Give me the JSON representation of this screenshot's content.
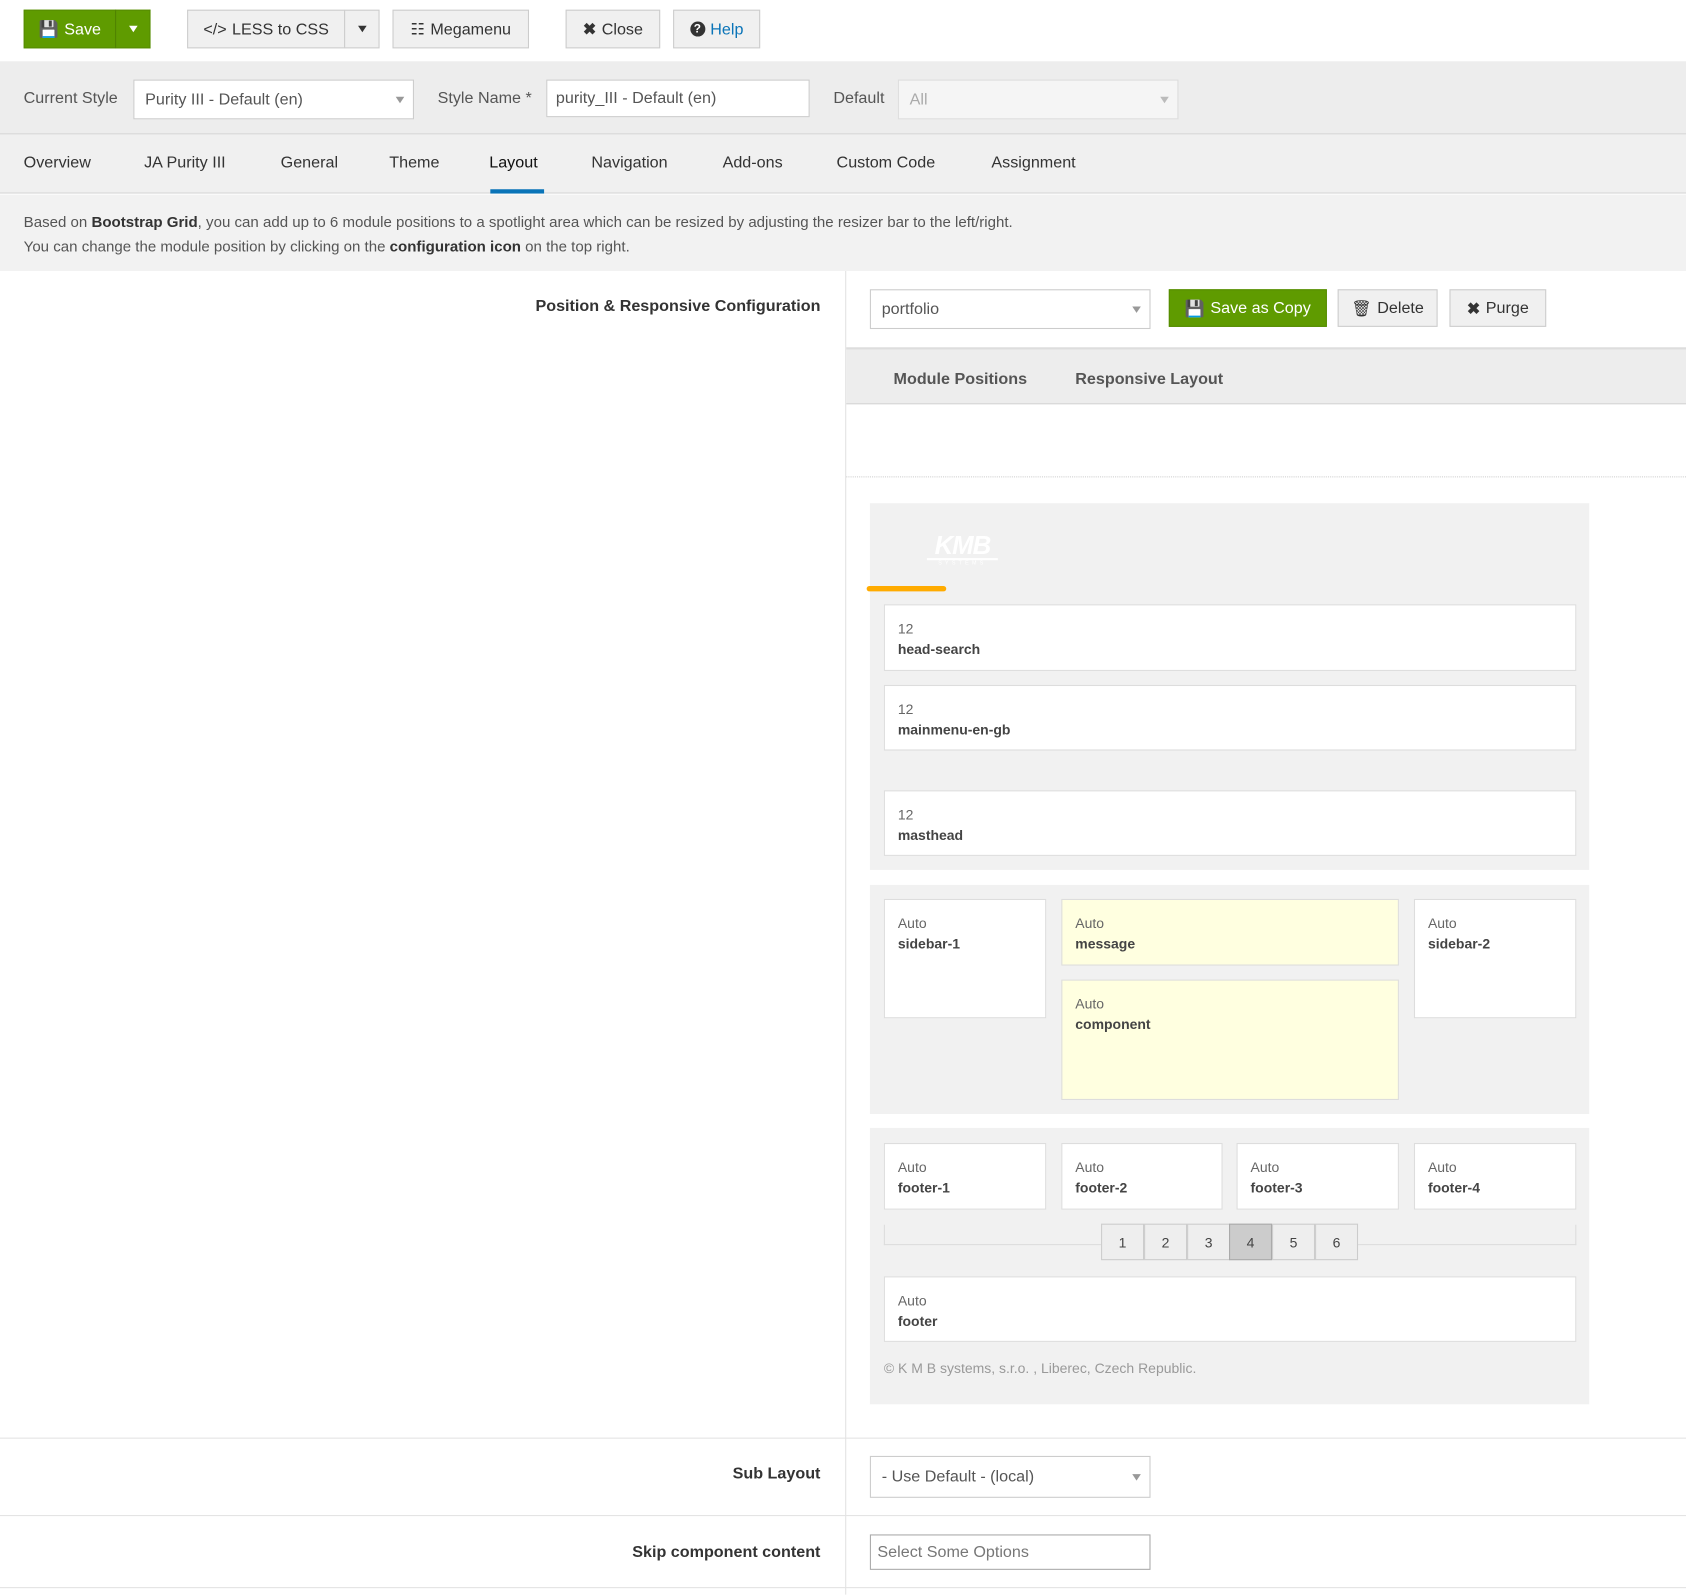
{
  "toolbar": {
    "save": "Save",
    "less": "LESS to CSS",
    "megamenu": "Megamenu",
    "close": "Close",
    "help": "Help"
  },
  "style_bar": {
    "current_style_label": "Current Style",
    "current_style_value": "Purity III - Default (en)",
    "style_name_label": "Style Name *",
    "style_name_value": "purity_III - Default (en)",
    "default_label": "Default",
    "default_value": "All"
  },
  "tabs": [
    "Overview",
    "JA Purity III",
    "General",
    "Theme",
    "Layout",
    "Navigation",
    "Add-ons",
    "Custom Code",
    "Assignment"
  ],
  "active_tab": "Layout",
  "info": {
    "l1a": "Based on ",
    "l1b": "Bootstrap Grid",
    "l1c": ", you can add up to 6 module positions to a spotlight area which can be resized by adjusting the resizer bar to the left/right.",
    "l2a": "You can change the module position by clicking on the ",
    "l2b": "configuration icon",
    "l2c": " on the top right."
  },
  "config": {
    "label": "Position & Responsive Configuration",
    "layout_value": "portfolio",
    "save_copy": "Save as Copy",
    "delete": "Delete",
    "purge": "Purge"
  },
  "subtabs": [
    "Module Positions",
    "Responsive Layout"
  ],
  "logo_text": "KMB SYSTEMS",
  "header_positions": [
    {
      "width": "12",
      "name": "head-search"
    },
    {
      "width": "12",
      "name": "mainmenu-en-gb"
    },
    {
      "width": "12",
      "name": "masthead"
    }
  ],
  "main_positions": {
    "sidebar1": {
      "width": "Auto",
      "name": "sidebar-1"
    },
    "message": {
      "width": "Auto",
      "name": "message"
    },
    "component": {
      "width": "Auto",
      "name": "component"
    },
    "sidebar2": {
      "width": "Auto",
      "name": "sidebar-2"
    }
  },
  "footer_positions": [
    {
      "width": "Auto",
      "name": "footer-1"
    },
    {
      "width": "Auto",
      "name": "footer-2"
    },
    {
      "width": "Auto",
      "name": "footer-3"
    },
    {
      "width": "Auto",
      "name": "footer-4"
    }
  ],
  "column_counts": [
    "1",
    "2",
    "3",
    "4",
    "5",
    "6"
  ],
  "active_count": "4",
  "footer": {
    "width": "Auto",
    "name": "footer"
  },
  "copyright": "© K M B systems, s.r.o. , Liberec, Czech Republic.",
  "sub_layout": {
    "label": "Sub Layout",
    "value": "- Use Default - (local)"
  },
  "skip": {
    "label": "Skip component content",
    "placeholder": "Select Some Options"
  },
  "colors": {
    "green": "#5f9b00",
    "accent": "#0a74b8",
    "highlight": "#ffffe0",
    "orange": "#ffab00"
  }
}
